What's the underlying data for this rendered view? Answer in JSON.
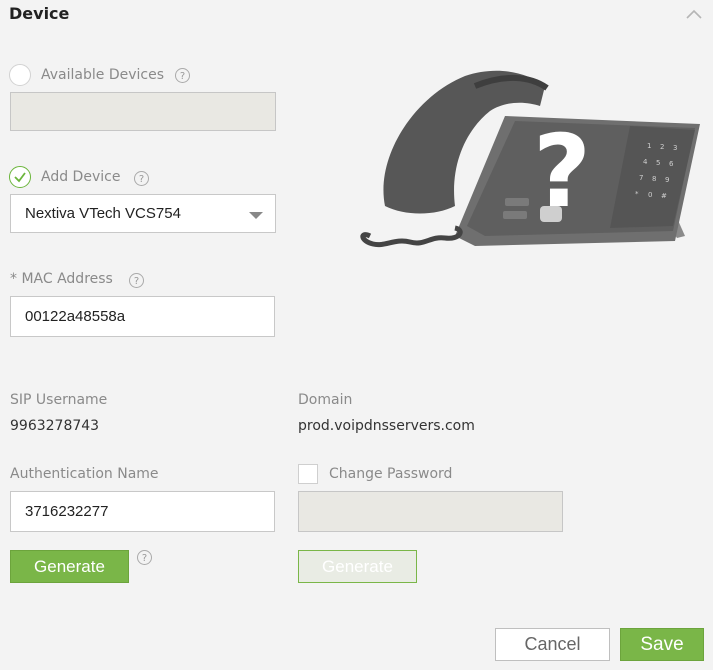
{
  "section": {
    "title": "Device"
  },
  "available_devices": {
    "label": "Available Devices",
    "help": "?",
    "value": ""
  },
  "add_device": {
    "label": "Add Device",
    "help": "?",
    "selected": "Nextiva VTech VCS754"
  },
  "mac": {
    "label": "* MAC Address",
    "help": "?",
    "value": "00122a48558a"
  },
  "sip": {
    "label": "SIP Username",
    "value": "9963278743"
  },
  "domain": {
    "label": "Domain",
    "value": "prod.voipdnsservers.com"
  },
  "auth": {
    "label": "Authentication Name",
    "value": "3716232277",
    "generate_label": "Generate",
    "help": "?"
  },
  "password": {
    "label": "Change Password",
    "value": "",
    "generate_label": "Generate"
  },
  "actions": {
    "cancel_label": "Cancel",
    "save_label": "Save"
  },
  "colors": {
    "accent": "#7ab648",
    "background": "#f3f3f3"
  },
  "icons": {
    "collapse": "chevron-up-icon",
    "device": "desk-phone-unknown-icon"
  }
}
